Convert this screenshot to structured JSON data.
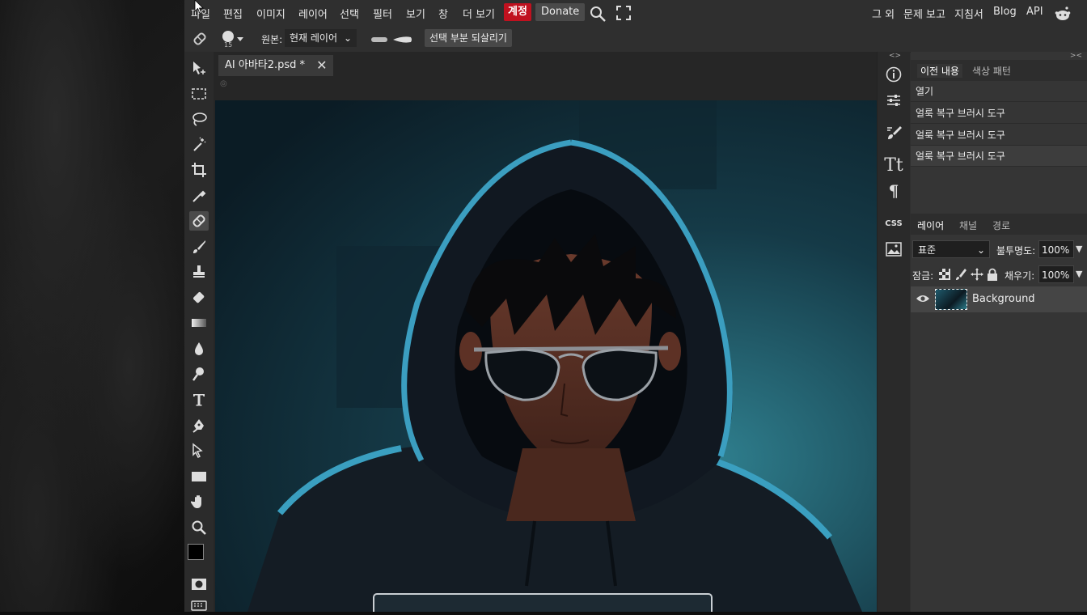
{
  "menu": {
    "items": [
      "파일",
      "편집",
      "이미지",
      "레이어",
      "선택",
      "필터",
      "보기",
      "창",
      "더 보기"
    ],
    "account": "계정",
    "donate": "Donate",
    "right_items": [
      "그 외",
      "문제 보고",
      "지침서",
      "Blog",
      "API"
    ]
  },
  "options": {
    "brush_size": "15",
    "source_label": "원본:",
    "source_value": "현재 레이어",
    "restore_button": "선택 부분 되살리기"
  },
  "document": {
    "tab_title": "AI 아바타2.psd *"
  },
  "mini_panel": {
    "css_label": "CSS"
  },
  "history_panel": {
    "tabs": [
      "이전 내용",
      "색상 패턴"
    ],
    "entries": [
      "열기",
      "얼룩 복구 브러시 도구",
      "얼룩 복구 브러시 도구",
      "얼룩 복구 브러시 도구"
    ]
  },
  "layers_panel": {
    "tabs": [
      "레이어",
      "채널",
      "경로"
    ],
    "blend_mode": "표준",
    "opacity_label": "불투명도:",
    "opacity_value": "100%",
    "lock_label": "잠금:",
    "fill_label": "채우기:",
    "fill_value": "100%",
    "layers": [
      {
        "name": "Background"
      }
    ]
  },
  "colors": {
    "accent_account": "#c0111f",
    "foreground": "#000000",
    "background": "#ffffff"
  }
}
